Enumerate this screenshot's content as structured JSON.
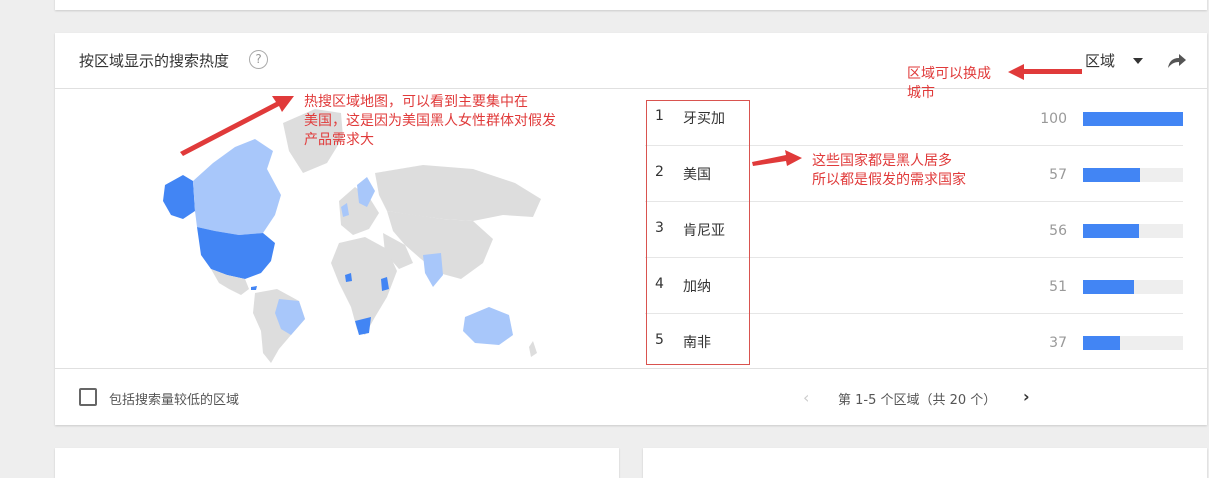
{
  "panel": {
    "title": "按区域显示的搜索热度",
    "help_icon": "?",
    "region_select_label": "区域"
  },
  "rankings": [
    {
      "rank": "1",
      "name": "牙买加",
      "value": "100",
      "score": 100
    },
    {
      "rank": "2",
      "name": "美国",
      "value": "57",
      "score": 57
    },
    {
      "rank": "3",
      "name": "肯尼亚",
      "value": "56",
      "score": 56
    },
    {
      "rank": "4",
      "name": "加纳",
      "value": "51",
      "score": 51
    },
    {
      "rank": "5",
      "name": "南非",
      "value": "37",
      "score": 37
    }
  ],
  "footer": {
    "checkbox_label": "包括搜索量较低的区域",
    "pagination_text": "第 1-5 个区域（共 20 个）",
    "prev_icon": "‹",
    "next_icon": "›"
  },
  "annotations": {
    "map_note": "热搜区域地图，可以看到主要集中在\n美国，这是因为美国黑人女性群体对假发\n产品需求大",
    "city_note": "区域可以换成\n城市",
    "country_note": "这些国家都是黑人居多\n所以都是假发的需求国家"
  },
  "colors": {
    "bar": "#4285f4",
    "annotation": "#e03a3a",
    "map_dark": "#4285f4",
    "map_light": "#a8c7fa",
    "map_gray": "#dddddd"
  }
}
